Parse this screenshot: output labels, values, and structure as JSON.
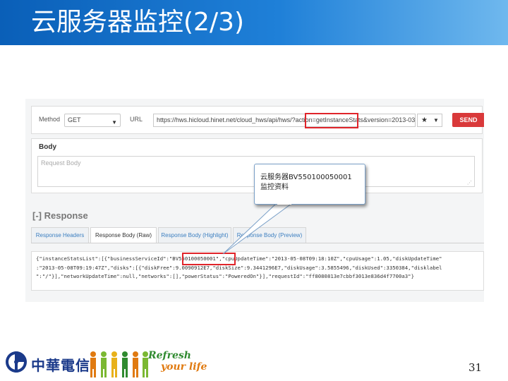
{
  "slide": {
    "title": "云服务器监控(2/3)",
    "page_number": "31"
  },
  "request": {
    "method_label": "Method",
    "method_value": "GET",
    "url_label": "URL",
    "url_value": "https://hws.hicloud.hinet.net/cloud_hws/api/hws/?action=getInstanceStats&version=2013-03-",
    "favorite_icon": "star-icon",
    "send_label": "SEND",
    "body_title": "Body",
    "body_placeholder": "Request Body"
  },
  "response": {
    "title": "[-] Response",
    "tabs": [
      "Response Headers",
      "Response Body (Raw)",
      "Response Body (Highlight)",
      "Response Body (Preview)"
    ],
    "active_tab": "Response Body (Raw)",
    "json_lines": [
      "{\"instanceStatsList\":[{\"businessServiceId\":\"BV550100050001\",\"cpuUpdateTime\":\"2013-05-08T09:18:10Z\",\"cpuUsage\":1.05,\"diskUpdateTime\"",
      ":\"2013-05-08T09:19:47Z\",\"disks\":[{\"diskFree\":9.0090912E7,\"diskSize\":9.3441296E7,\"diskUsage\":3.5855496,\"diskUsed\":3350384,\"disklabel",
      "\":\"/\"}],\"networkUpdateTime\":null,\"networks\":[],\"powerStatus\":\"PoweredOn\"}],\"requestId\":\"ff8080813e7cbbf3013e836d4f7700a3\"}"
    ]
  },
  "callout": {
    "line1": "云服务器BV550100050001",
    "line2": "监控资料"
  },
  "footer": {
    "company": "中華電信",
    "slogan_line1": "Refresh",
    "slogan_line2": "your life"
  },
  "colors": {
    "title_bar": "#1f80d8",
    "send_button": "#d9393a",
    "highlight_box": "#e0242a",
    "slogan_green": "#2f8a2f",
    "slogan_orange": "#e07a10"
  }
}
